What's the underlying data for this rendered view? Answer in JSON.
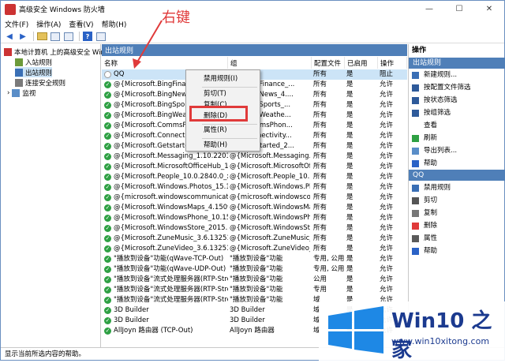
{
  "window": {
    "title": "高级安全 Windows 防火墙",
    "minimize": "—",
    "maximize": "☐",
    "close": "✕"
  },
  "menu": [
    "文件(F)",
    "操作(A)",
    "查看(V)",
    "帮助(H)"
  ],
  "tree": {
    "root": "本地计算机 上的高级安全 Wind",
    "items": [
      "入站规则",
      "出站规则",
      "连接安全规则",
      "监视"
    ]
  },
  "center": {
    "section_title": "出站规则",
    "columns": [
      "名称",
      "组",
      "配置文件",
      "已启用",
      "操作"
    ],
    "rows": [
      {
        "name": "QQ",
        "group": "",
        "profile": "所有",
        "enabled": "是",
        "action": "阻止",
        "on": false
      },
      {
        "name": "@{Microsoft.BingFinance_",
        "group": "soft.BingFinance_...",
        "profile": "所有",
        "enabled": "是",
        "action": "允许",
        "on": true
      },
      {
        "name": "@{Microsoft.BingNews_4.",
        "group": "soft.BingNews_4....",
        "profile": "所有",
        "enabled": "是",
        "action": "允许",
        "on": true
      },
      {
        "name": "@{Microsoft.BingSports_",
        "group": "soft.BingSports_...",
        "profile": "所有",
        "enabled": "是",
        "action": "允许",
        "on": true
      },
      {
        "name": "@{Microsoft.BingWeathe",
        "group": "soft.BingWeathe...",
        "profile": "所有",
        "enabled": "是",
        "action": "允许",
        "on": true
      },
      {
        "name": "@{Microsoft.CommsPhon",
        "group": "soft.CommsPhon...",
        "profile": "所有",
        "enabled": "是",
        "action": "允许",
        "on": true
      },
      {
        "name": "@{Microsoft.Connectivity",
        "group": "soft.Connectivity...",
        "profile": "所有",
        "enabled": "是",
        "action": "允许",
        "on": true
      },
      {
        "name": "@{Microsoft.Getstarted_2",
        "group": "soft.Getstarted_2...",
        "profile": "所有",
        "enabled": "是",
        "action": "允许",
        "on": true
      },
      {
        "name": "@{Microsoft.Messaging_1.10.22012.0...",
        "group": "@{Microsoft.Messaging...",
        "profile": "所有",
        "enabled": "是",
        "action": "允许",
        "on": true
      },
      {
        "name": "@{Microsoft.MicrosoftOfficeHub_17....",
        "group": "@{Microsoft.MicrosoftOff...",
        "profile": "所有",
        "enabled": "是",
        "action": "允许",
        "on": true
      },
      {
        "name": "@{Microsoft.People_10.0.2840.0_x86_...",
        "group": "@{Microsoft.People_10....",
        "profile": "所有",
        "enabled": "是",
        "action": "允许",
        "on": true
      },
      {
        "name": "@{Microsoft.Windows.Photos_15.100....",
        "group": "@{Microsoft.Windows.Ph...",
        "profile": "所有",
        "enabled": "是",
        "action": "允许",
        "on": true
      },
      {
        "name": "@{microsoft.windowscommunication...",
        "group": "@{microsoft.windowscom...",
        "profile": "所有",
        "enabled": "是",
        "action": "允许",
        "on": true
      },
      {
        "name": "@{Microsoft.WindowsMaps_4.1509.5...",
        "group": "@{Microsoft.WindowsMa...",
        "profile": "所有",
        "enabled": "是",
        "action": "允许",
        "on": true
      },
      {
        "name": "@{Microsoft.WindowsPhone_10.1510....",
        "group": "@{Microsoft.WindowsPh...",
        "profile": "所有",
        "enabled": "是",
        "action": "允许",
        "on": true
      },
      {
        "name": "@{Microsoft.WindowsStore_2015.10....",
        "group": "@{Microsoft.WindowsSto...",
        "profile": "所有",
        "enabled": "是",
        "action": "允许",
        "on": true
      },
      {
        "name": "@{Microsoft.ZuneMusic_3.6.13251.0_...",
        "group": "@{Microsoft.ZuneMusic_3...",
        "profile": "所有",
        "enabled": "是",
        "action": "允许",
        "on": true
      },
      {
        "name": "@{Microsoft.ZuneVideo_3.6.13251.0_...",
        "group": "@{Microsoft.ZuneVideo_3...",
        "profile": "所有",
        "enabled": "是",
        "action": "允许",
        "on": true
      },
      {
        "name": "\"播放到设备\"功能(qWave-TCP-Out)",
        "group": "\"播放到设备\"功能",
        "profile": "专用, 公用",
        "enabled": "是",
        "action": "允许",
        "on": true
      },
      {
        "name": "\"播放到设备\"功能(qWave-UDP-Out)",
        "group": "\"播放到设备\"功能",
        "profile": "专用, 公用",
        "enabled": "是",
        "action": "允许",
        "on": true
      },
      {
        "name": "\"播放到设备\"流式处理服务器(RTP-Strea...",
        "group": "\"播放到设备\"功能",
        "profile": "公用",
        "enabled": "是",
        "action": "允许",
        "on": true
      },
      {
        "name": "\"播放到设备\"流式处理服务器(RTP-Strea...",
        "group": "\"播放到设备\"功能",
        "profile": "专用",
        "enabled": "是",
        "action": "允许",
        "on": true
      },
      {
        "name": "\"播放到设备\"流式处理服务器(RTP-Strea...",
        "group": "\"播放到设备\"功能",
        "profile": "域",
        "enabled": "是",
        "action": "允许",
        "on": true
      },
      {
        "name": "3D Builder",
        "group": "3D Builder",
        "profile": "域",
        "enabled": "是",
        "action": "允许",
        "on": true
      },
      {
        "name": "3D Builder",
        "group": "3D Builder",
        "profile": "域",
        "enabled": "是",
        "action": "允许",
        "on": true
      },
      {
        "name": "AllJoyn 路由器 (TCP-Out)",
        "group": "AllJoyn 路由器",
        "profile": "域",
        "enabled": "是",
        "action": "允许",
        "on": true
      }
    ]
  },
  "context_menu": [
    "禁用规则(I)",
    "剪切(T)",
    "复制(C)",
    "删除(D)",
    "属性(R)",
    "帮助(H)"
  ],
  "annotation": {
    "label": "右键",
    "color": "#e03a3a"
  },
  "actions": {
    "title": "操作",
    "section1": "出站规则",
    "items1": [
      "新建规则...",
      "按配置文件筛选",
      "按状态筛选",
      "按组筛选",
      "查看",
      "刷新",
      "导出列表...",
      "帮助"
    ],
    "section2": "QQ",
    "items2": [
      "禁用规则",
      "剪切",
      "复制",
      "删除",
      "属性",
      "帮助"
    ]
  },
  "status": "显示当前所选内容的帮助。",
  "watermark": {
    "brand": "Win10 之家",
    "url": "www.win10xitong.com"
  },
  "colors": {
    "accent": "#4f7fb8",
    "selection": "#cce4f7",
    "highlight": "#e03a3a",
    "brand": "#1b3a8f"
  }
}
